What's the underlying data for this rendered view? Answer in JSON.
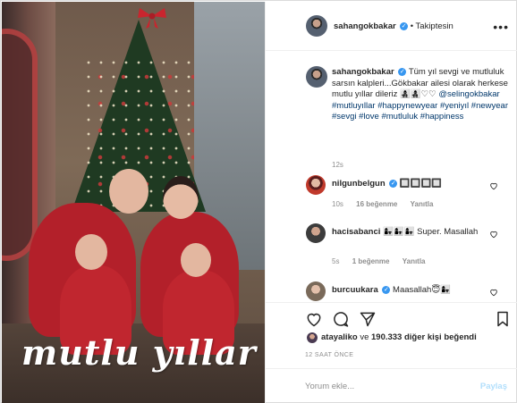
{
  "post": {
    "username": "sahangokbakar",
    "verified": true,
    "follow_status": "Takiptesin",
    "photo_caption_text": "mutlu yıllar",
    "caption": {
      "text": "Tüm yıl sevgi ve mutluluk sarsın kalpleri...Gökbakar ailesi olarak herkese mutlu yıllar dileriz",
      "emojis": "👩‍👧‍👦👩‍👧‍👦♡♡",
      "mention": "@selingokbakar",
      "hashtags": [
        "#mutluyıllar",
        "#happynewyear",
        "#yeniyıl",
        "#newyear",
        "#sevgi",
        "#love",
        "#mutluluk",
        "#happiness"
      ],
      "time": "12s"
    },
    "comments": [
      {
        "username": "nilgunbelgun",
        "verified": true,
        "text": "🔲🔲🔲🔲",
        "time": "10s",
        "likes": "16 beğenme",
        "reply": "Yanıtla"
      },
      {
        "username": "hacisabanci",
        "verified": false,
        "text": "👩‍👧👩‍👧👩‍👧 Super. Masallah",
        "time": "5s",
        "likes": "1 beğenme",
        "reply": "Yanıtla"
      },
      {
        "username": "burcuukara",
        "verified": true,
        "text": "Maasallah😇👩‍👧",
        "time": "",
        "likes": "",
        "reply": ""
      }
    ],
    "likes_summary": {
      "user": "atayaliko",
      "connector": "ve",
      "count": "190.333",
      "suffix": "diğer kişi beğendi"
    },
    "timestamp": "12 SAAT ÖNCE",
    "add_comment": {
      "placeholder": "Yorum ekle...",
      "post_label": "Paylaş"
    }
  },
  "icons": {
    "like": "heart-icon",
    "comment": "comment-icon",
    "share": "paper-plane-icon",
    "save": "bookmark-icon",
    "more": "more-options-icon",
    "verified": "verified-badge-icon"
  },
  "colors": {
    "link": "#00376b",
    "verified": "#3897f0",
    "muted": "#8e8e8e",
    "post_disabled": "#b2dffc"
  }
}
